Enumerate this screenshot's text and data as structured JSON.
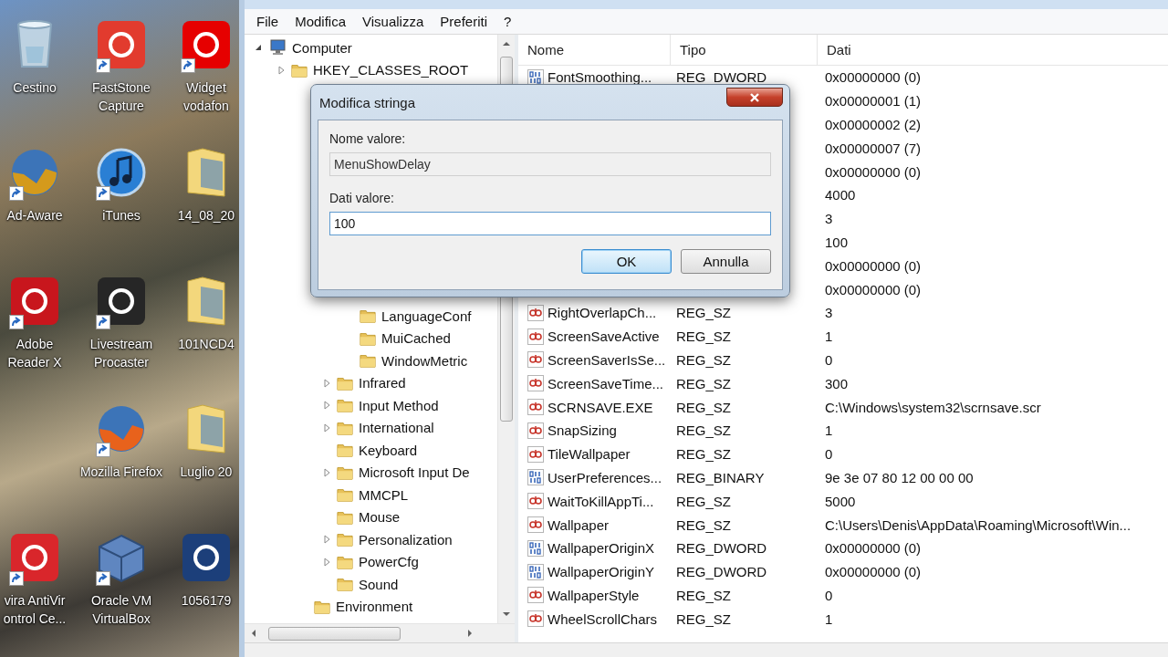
{
  "desktop": {
    "columns": [
      {
        "icons": [
          {
            "label": "Cestino",
            "kind": "trash",
            "shortcut": false
          },
          {
            "label": "Ad-Aware",
            "kind": "globe",
            "color": "#d49a1c",
            "shortcut": true
          },
          {
            "label": "Adobe Reader X",
            "kind": "tile",
            "color": "#c8161d",
            "shortcut": true
          },
          {
            "kind": "blank"
          },
          {
            "label": "vira AntiVir ontrol Ce...",
            "kind": "tile",
            "color": "#d9262b",
            "shortcut": true
          }
        ]
      },
      {
        "icons": [
          {
            "label": "FastStone Capture",
            "kind": "tile",
            "color": "#e23b2e",
            "shortcut": true
          },
          {
            "label": "iTunes",
            "kind": "music",
            "color": "#2a7fd4",
            "shortcut": true
          },
          {
            "label": "Livestream Procaster",
            "kind": "tile",
            "color": "#262626",
            "shortcut": true
          },
          {
            "label": "Mozilla Firefox",
            "kind": "globe",
            "color": "#e8621c",
            "shortcut": true
          },
          {
            "label": "Oracle VM VirtualBox",
            "kind": "cube",
            "color": "#5f86c0",
            "shortcut": true
          }
        ]
      },
      {
        "icons": [
          {
            "label": "Widget vodafon",
            "kind": "tile",
            "color": "#e60000",
            "shortcut": true
          },
          {
            "label": "14_08_20",
            "kind": "folder",
            "shortcut": false
          },
          {
            "label": "101NCD4",
            "kind": "folder",
            "shortcut": false
          },
          {
            "label": "Luglio 20",
            "kind": "folder",
            "shortcut": false
          },
          {
            "label": "1056179",
            "kind": "tile",
            "color": "#1c3f7a",
            "shortcut": false
          }
        ]
      }
    ]
  },
  "menu": [
    "File",
    "Modifica",
    "Visualizza",
    "Preferiti",
    "?"
  ],
  "tree": {
    "items": [
      {
        "label": "Computer",
        "kind": "computer",
        "expanded": true,
        "children": [
          {
            "label": "HKEY_CLASSES_ROOT",
            "expanded": false
          },
          {
            "children": [
              {
                "children": [
                  {
                    "children": [
                      {
                        "label": "LanguageConf"
                      },
                      {
                        "label": "MuiCached"
                      },
                      {
                        "label": "WindowMetric"
                      }
                    ]
                  },
                  {
                    "label": "Infrared",
                    "expanded": false
                  },
                  {
                    "label": "Input Method",
                    "expanded": false
                  },
                  {
                    "label": "International",
                    "expanded": false
                  },
                  {
                    "label": "Keyboard"
                  },
                  {
                    "label": "Microsoft Input De",
                    "expanded": false
                  },
                  {
                    "label": "MMCPL"
                  },
                  {
                    "label": "Mouse"
                  },
                  {
                    "label": "Personalization",
                    "expanded": false
                  },
                  {
                    "label": "PowerCfg",
                    "expanded": false
                  },
                  {
                    "label": "Sound"
                  }
                ]
              },
              {
                "label": "Environment"
              }
            ]
          }
        ]
      }
    ]
  },
  "list": {
    "columns": [
      "Nome",
      "Tipo",
      "Dati"
    ],
    "rows": [
      {
        "name": "FontSmoothing...",
        "type": "REG_DWORD",
        "data": "0x00000000 (0)",
        "kind": "dword"
      },
      {
        "data": "0x00000001 (1)"
      },
      {
        "data": "0x00000002 (2)"
      },
      {
        "data": "0x00000007 (7)"
      },
      {
        "data": "0x00000000 (0)"
      },
      {
        "data": "4000"
      },
      {
        "data": "3"
      },
      {
        "data": "100"
      },
      {
        "data": "0x00000000 (0)"
      },
      {
        "data": "0x00000000 (0)"
      },
      {
        "name": "RightOverlapCh...",
        "type": "REG_SZ",
        "data": "3",
        "kind": "sz"
      },
      {
        "name": "ScreenSaveActive",
        "type": "REG_SZ",
        "data": "1",
        "kind": "sz"
      },
      {
        "name": "ScreenSaverIsSe...",
        "type": "REG_SZ",
        "data": "0",
        "kind": "sz"
      },
      {
        "name": "ScreenSaveTime...",
        "type": "REG_SZ",
        "data": "300",
        "kind": "sz"
      },
      {
        "name": "SCRNSAVE.EXE",
        "type": "REG_SZ",
        "data": "C:\\Windows\\system32\\scrnsave.scr",
        "kind": "sz"
      },
      {
        "name": "SnapSizing",
        "type": "REG_SZ",
        "data": "1",
        "kind": "sz"
      },
      {
        "name": "TileWallpaper",
        "type": "REG_SZ",
        "data": "0",
        "kind": "sz"
      },
      {
        "name": "UserPreferences...",
        "type": "REG_BINARY",
        "data": "9e 3e 07 80 12 00 00 00",
        "kind": "binary"
      },
      {
        "name": "WaitToKillAppTi...",
        "type": "REG_SZ",
        "data": "5000",
        "kind": "sz"
      },
      {
        "name": "Wallpaper",
        "type": "REG_SZ",
        "data": "C:\\Users\\Denis\\AppData\\Roaming\\Microsoft\\Win...",
        "kind": "sz"
      },
      {
        "name": "WallpaperOriginX",
        "type": "REG_DWORD",
        "data": "0x00000000 (0)",
        "kind": "dword"
      },
      {
        "name": "WallpaperOriginY",
        "type": "REG_DWORD",
        "data": "0x00000000 (0)",
        "kind": "dword"
      },
      {
        "name": "WallpaperStyle",
        "type": "REG_SZ",
        "data": "0",
        "kind": "sz"
      },
      {
        "name": "WheelScrollChars",
        "type": "REG_SZ",
        "data": "1",
        "kind": "sz"
      }
    ]
  },
  "dialog": {
    "title": "Modifica stringa",
    "name_label": "Nome valore:",
    "name_value": "MenuShowDelay",
    "data_label": "Dati valore:",
    "data_value": "100",
    "buttons": [
      {
        "label": "OK",
        "default": true
      },
      {
        "label": "Annulla",
        "default": false
      }
    ]
  }
}
